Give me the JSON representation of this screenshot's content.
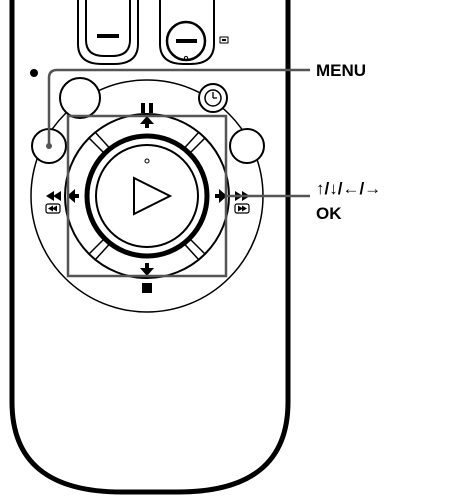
{
  "callouts": {
    "menu": "MENU",
    "arrows": "↑/↓/←/→",
    "ok": "OK"
  },
  "button_symbols": {
    "pause": "II",
    "rewind": "◀◀",
    "fast_forward": "▶▶",
    "stop": "■",
    "play": "▷",
    "timer": "◷",
    "display": "⧈"
  },
  "colors": {
    "line": "#000000",
    "fill": "#ffffff"
  }
}
